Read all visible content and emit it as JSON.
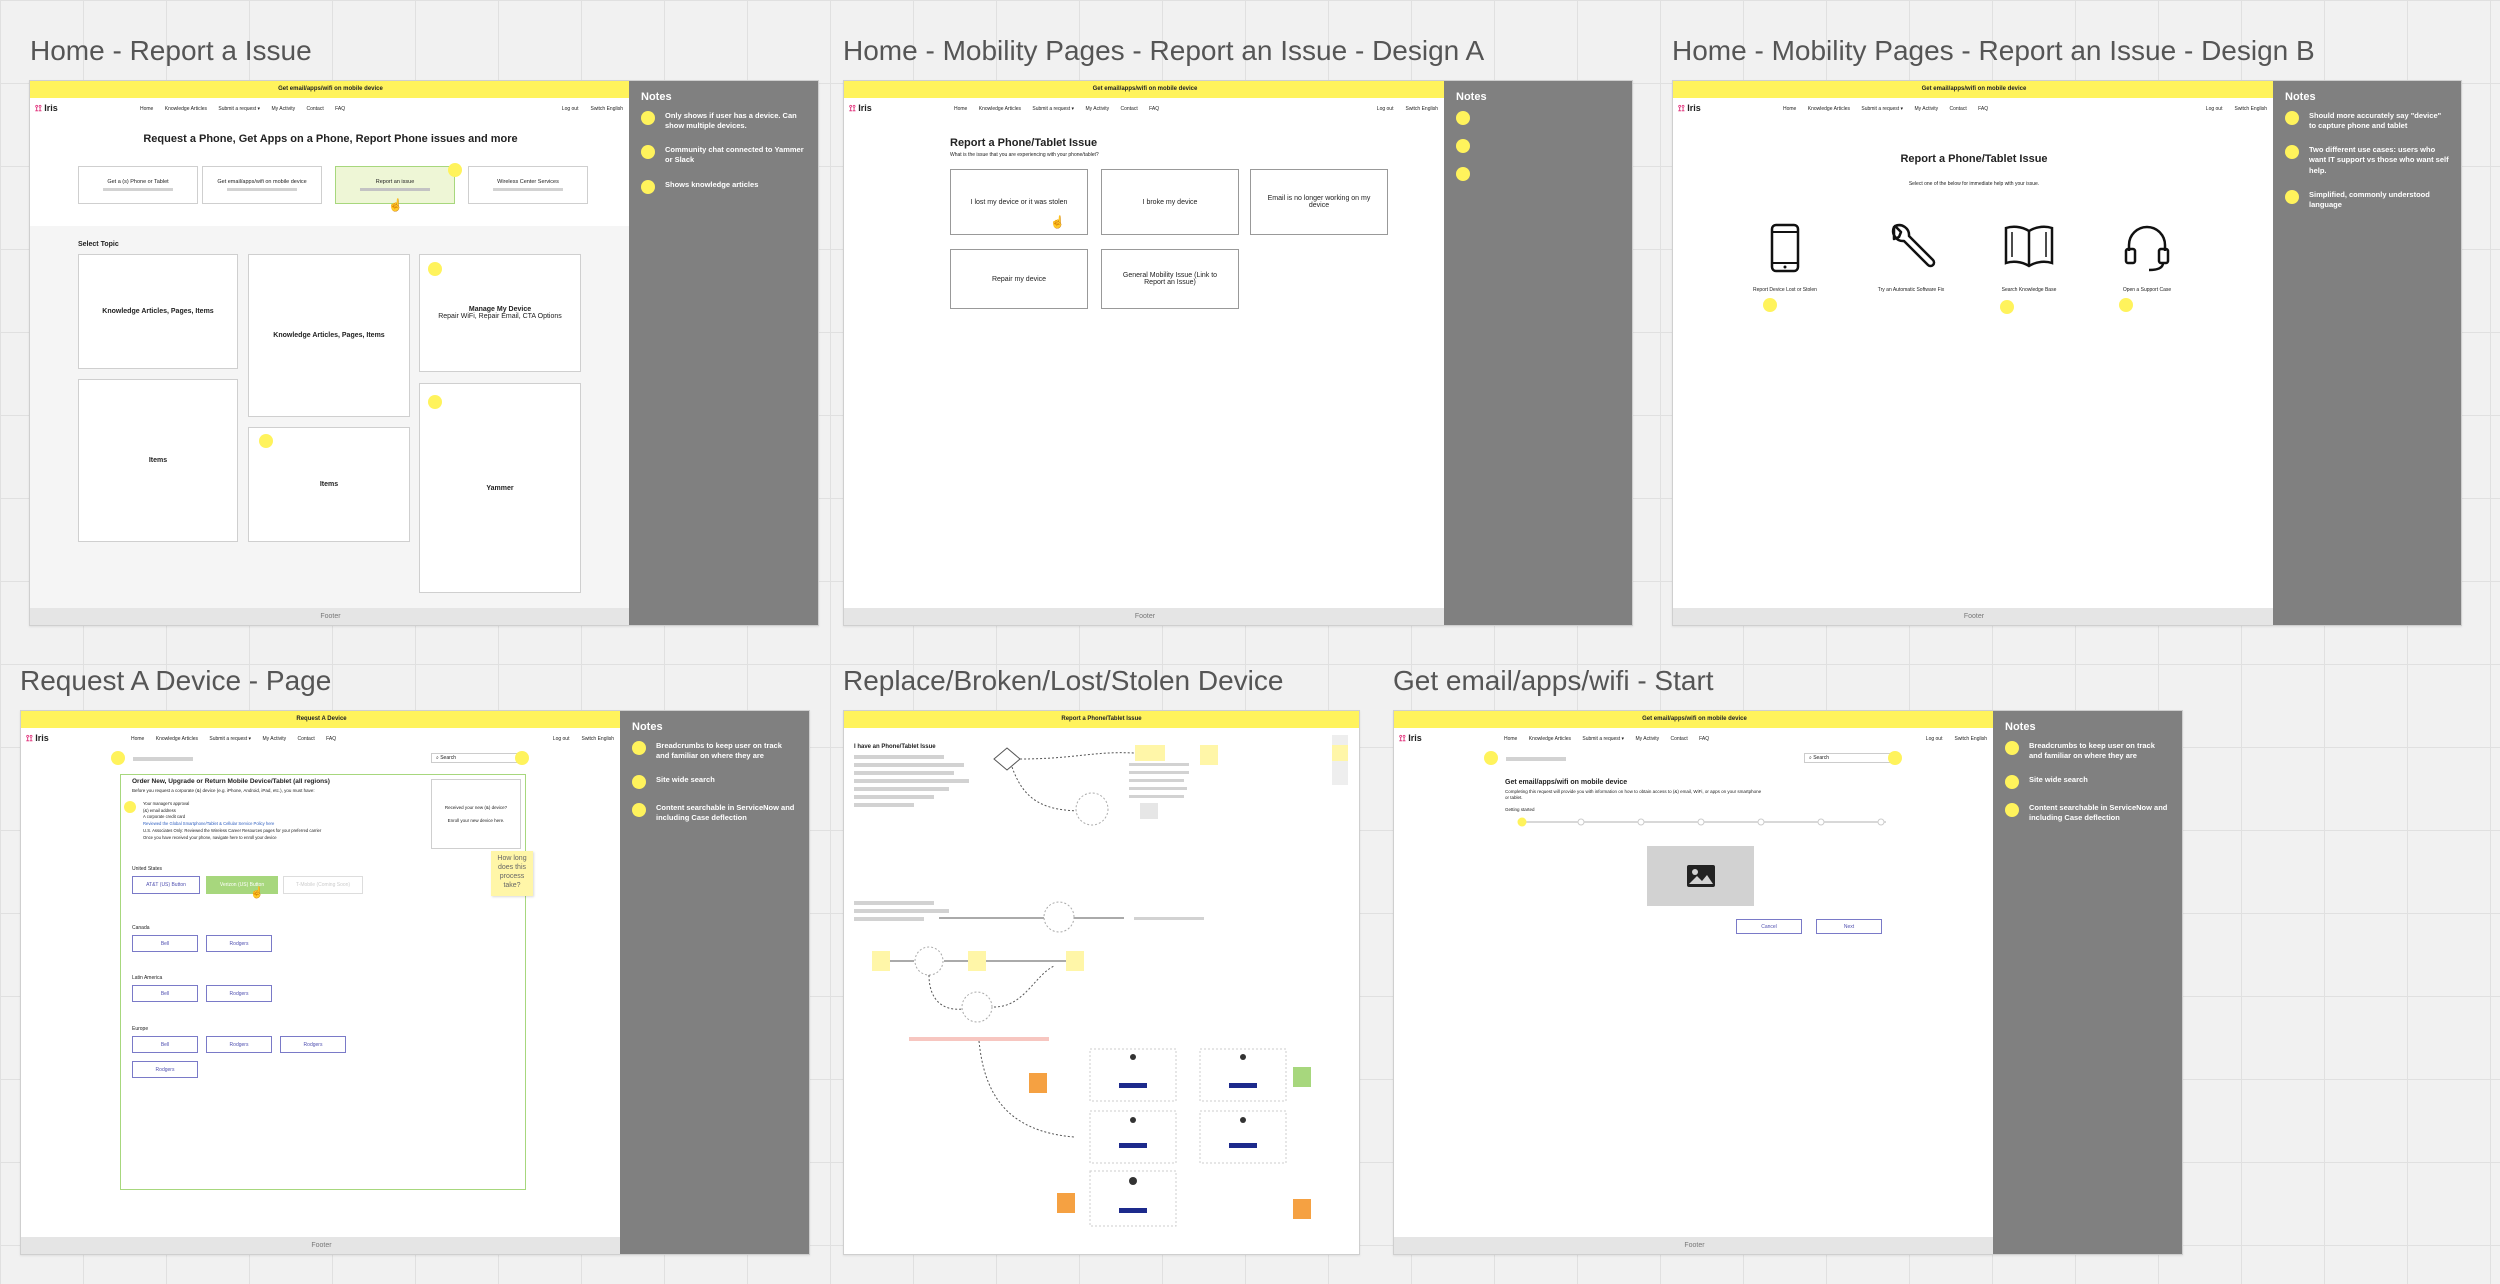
{
  "frames": {
    "home": {
      "title": "Home - Report a Issue"
    },
    "design_a": {
      "title": "Home - Mobility Pages - Report an Issue - Design A"
    },
    "design_b": {
      "title": "Home - Mobility Pages - Report an Issue - Design B"
    },
    "request_device": {
      "title": "Request A Device - Page"
    },
    "replace": {
      "title": "Replace/Broken/Lost/Stolen Device"
    },
    "get_email": {
      "title": "Get email/apps/wifi - Start"
    }
  },
  "common": {
    "banner": "Get email/apps/wifi on mobile device",
    "logo": "Iris",
    "nav_links": [
      "Home",
      "Knowledge Articles",
      "Submit a request ▾",
      "My Activity",
      "Contact",
      "FAQ"
    ],
    "nav_right": [
      "Log out",
      "Switch English"
    ],
    "footer": "Footer",
    "notes_heading": "Notes"
  },
  "home": {
    "heading": "Request a Phone, Get Apps on a Phone, Report Phone issues and more",
    "options": [
      "Get a (s) Phone or Tablet",
      "Get email/apps/wifi on mobile device",
      "Report an issue",
      "Wireless Center Services"
    ],
    "select_topic": "Select Topic",
    "tiles": {
      "ka1": "Knowledge Articles, Pages, Items",
      "ka2": "Knowledge Articles, Pages, Items",
      "manage_title": "Manage My Device",
      "manage_sub": "Repair WiFi, Repair Email, CTA Options",
      "items1": "Items",
      "items2": "Items",
      "yammer": "Yammer"
    },
    "notes": [
      "Only shows if user has a device. Can show multiple devices.",
      "Community chat connected to Yammer or Slack",
      "Shows knowledge articles"
    ]
  },
  "design_a": {
    "heading": "Report a Phone/Tablet Issue",
    "subheading": "What is the issue that you are experiencing with your phone/tablet?",
    "options": [
      "I lost my device or it was stolen",
      "I broke my device",
      "Email is no longer working on my device",
      "Repair my device",
      "General Mobility Issue (Link to Report an Issue)"
    ]
  },
  "design_b": {
    "heading": "Report a Phone/Tablet Issue",
    "subheading": "Select one of the below for immediate help with your issue.",
    "icons": [
      {
        "icon": "phone-icon",
        "label": "Report Device Lost or Stolen"
      },
      {
        "icon": "wrench-icon",
        "label": "Try an Automatic Software Fix"
      },
      {
        "icon": "book-icon",
        "label": "Search Knowledge Base"
      },
      {
        "icon": "headset-icon",
        "label": "Open a Support Case"
      }
    ],
    "notes": [
      "Should more accurately say \"device\" to capture phone and tablet",
      "Two different use cases: users who want IT support vs those who want self help.",
      "Simplified, commonly understood language"
    ]
  },
  "request_device": {
    "banner": "Request A Device",
    "search": "Search",
    "order_heading": "Order New, Upgrade or Return Mobile Device/Tablet (all regions)",
    "intro": "Before you request a corporate (&) device (e.g. iPhone, Android, iPad, etc.), you must have:",
    "checklist": [
      "Your manager's approval",
      "(&) email address",
      "A corporate credit card",
      "Reviewed the Global Smartphone/Tablet & Cellular Service Policy here",
      "U.S. Associates Only: Reviewed the Wireless Career Resources pages for your preferred carrier",
      "Once you have received your phone, navigate here to enroll your device"
    ],
    "side_card": [
      "Received your new (&) device?",
      "Enroll your new device here."
    ],
    "tooltip": "How long does this process take?",
    "regions": [
      {
        "name": "United States",
        "buttons": [
          "AT&T (US) Button",
          "Verizon (US) Button",
          "T-Mobile (Coming Soon)"
        ]
      },
      {
        "name": "Canada",
        "buttons": [
          "Bell",
          "Rodgers"
        ]
      },
      {
        "name": "Latin America",
        "buttons": [
          "Bell",
          "Rodgers"
        ]
      },
      {
        "name": "Europe",
        "buttons": [
          "Bell",
          "Rodgers",
          "Rodgers",
          "Rodgers"
        ]
      }
    ],
    "notes": [
      "Breadcrumbs to keep user on track and familiar on where they are",
      "Site wide search",
      "Content searchable in ServiceNow and including Case deflection"
    ]
  },
  "replace": {
    "banner": "Report a Phone/Tablet Issue",
    "heading": "I have an Phone/Tablet Issue"
  },
  "get_email": {
    "search": "Search",
    "heading": "Get email/apps/wifi on mobile device",
    "description": "Completing this request will provide you with information on how to obtain access to (&) email, WiFi, or apps on your smartphone or tablet.",
    "getting_started": "Getting started",
    "cancel": "Cancel",
    "next": "Next",
    "notes": [
      "Breadcrumbs to keep user on track and familiar on where they are",
      "Site wide search",
      "Content searchable in ServiceNow and including Case deflection"
    ]
  },
  "colors": {
    "sticky": "#fff35c",
    "notes_panel": "#808080",
    "selected_green": "#a7d77d",
    "orange": "#f5a142"
  }
}
